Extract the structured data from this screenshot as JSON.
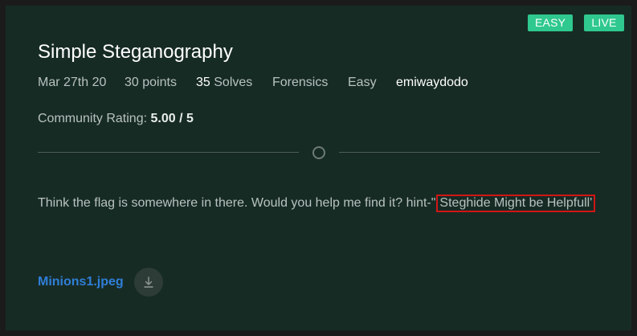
{
  "badges": {
    "difficulty": "EASY",
    "status": "LIVE"
  },
  "challenge": {
    "title": "Simple Steganography",
    "date": "Mar 27th 20",
    "points": "30 points",
    "solves_count": "35",
    "solves_label": "Solves",
    "category": "Forensics",
    "difficulty": "Easy",
    "author": "emiwaydodo"
  },
  "rating": {
    "label": "Community Rating:",
    "value": "5.00 / 5"
  },
  "description": {
    "text": "Think the flag is somewhere in there. Would you help me find it? hint-\"",
    "highlight": "Steghide Might be Helpfull'"
  },
  "attachment": {
    "filename": "Minions1.jpeg",
    "icon": "download-icon"
  },
  "colors": {
    "badge": "#2fc88f",
    "card_bg": "#172b25",
    "link": "#2f7fd8",
    "highlight_border": "#d21515"
  }
}
